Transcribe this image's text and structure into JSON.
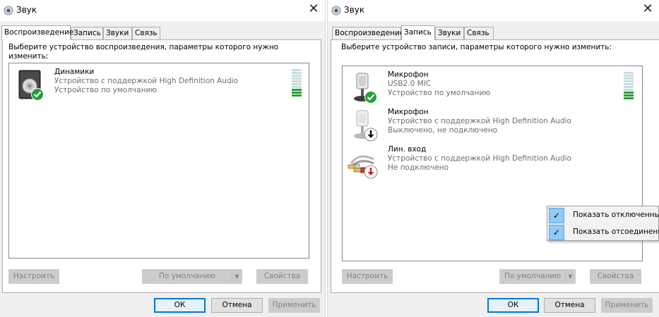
{
  "colors": {
    "accent": "#0078d7",
    "meter_on": "#2e9b37",
    "check_bg": "#91c9f7"
  },
  "window_left": {
    "title": "Звук",
    "tabs": [
      "Воспроизведение",
      "Запись",
      "Звуки",
      "Связь"
    ],
    "active_tab": "Воспроизведение",
    "instruction": "Выберите устройство воспроизведения, параметры которого нужно изменить:",
    "devices": [
      {
        "name": "Динамики",
        "line1": "Устройство с поддержкой High Definition Audio",
        "line2": "Устройство по умолчанию",
        "icon": "speaker-icon",
        "status": "default-check"
      }
    ],
    "meter_level": 0.3,
    "buttons": {
      "configure": "Настроить",
      "set_default": "По умолчанию",
      "properties": "Свойства",
      "ok": "ОК",
      "cancel": "Отмена",
      "apply": "Применить"
    }
  },
  "window_right": {
    "title": "Звук",
    "tabs": [
      "Воспроизведение",
      "Запись",
      "Звуки",
      "Связь"
    ],
    "active_tab": "Запись",
    "instruction": "Выберите устройство записи, параметры которого нужно изменить:",
    "devices": [
      {
        "name": "Микрофон",
        "line1": "USB2.0 MIC",
        "line2": "Устройство по умолчанию",
        "icon": "microphone-icon",
        "status": "default-check"
      },
      {
        "name": "Микрофон",
        "line1": "Устройство с поддержкой High Definition Audio",
        "line2": "Выключено, не подключено",
        "icon": "microphone-icon",
        "status": "disabled-arrow"
      },
      {
        "name": "Лин. вход",
        "line1": "Устройство с поддержкой High Definition Audio",
        "line2": "Не подключено",
        "icon": "line-in-cable-icon",
        "status": "unplugged-arrow"
      }
    ],
    "meter_level": 0.3,
    "buttons": {
      "configure": "Настроить",
      "set_default": "По умолчанию",
      "properties": "Свойства",
      "ok": "ОК",
      "cancel": "Отмена",
      "apply": "Применить"
    },
    "context_menu": [
      {
        "label": "Показать отключенны",
        "checked": true
      },
      {
        "label": "Показать отсоединенн",
        "checked": true
      }
    ]
  }
}
